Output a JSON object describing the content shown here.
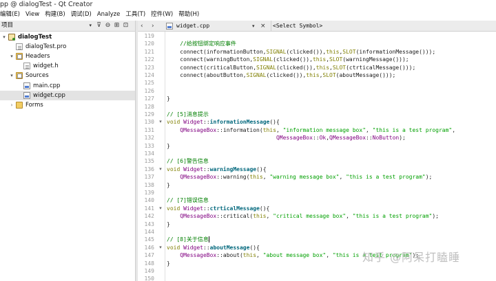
{
  "window": {
    "title": "pp @ dialogTest - Qt Creator"
  },
  "menu": [
    "编辑(E)",
    "View",
    "构建(B)",
    "调试(D)",
    "Analyze",
    "工具(T)",
    "控件(W)",
    "帮助(H)"
  ],
  "project_panel": {
    "combo_label": "项目",
    "tree": [
      {
        "label": "dialogTest",
        "level": 0,
        "expander": "▾",
        "icon": "project-icon",
        "bold": true
      },
      {
        "label": "dialogTest.pro",
        "level": 1,
        "expander": "",
        "icon": "pro-file-icon"
      },
      {
        "label": "Headers",
        "level": 1,
        "expander": "▾",
        "icon": "headers-folder-icon"
      },
      {
        "label": "widget.h",
        "level": 2,
        "expander": "",
        "icon": "header-file-icon"
      },
      {
        "label": "Sources",
        "level": 1,
        "expander": "▾",
        "icon": "sources-folder-icon"
      },
      {
        "label": "main.cpp",
        "level": 2,
        "expander": "",
        "icon": "cpp-file-icon"
      },
      {
        "label": "widget.cpp",
        "level": 2,
        "expander": "",
        "icon": "cpp-file-icon",
        "selected": true
      },
      {
        "label": "Forms",
        "level": 1,
        "expander": "›",
        "icon": "forms-folder-icon"
      }
    ]
  },
  "editor": {
    "file_name": "widget.cpp",
    "symbol_combo": "<Select Symbol>",
    "lines": [
      {
        "n": "119",
        "fold": "",
        "tokens": []
      },
      {
        "n": "120",
        "fold": "",
        "tokens": [
          {
            "c": "    "
          },
          {
            "c": "//给按钮绑定响应事件",
            "k": "c"
          }
        ]
      },
      {
        "n": "121",
        "fold": "",
        "tokens": [
          {
            "c": "    connect(informationButton,"
          },
          {
            "c": "SIGNAL",
            "k": "k"
          },
          {
            "c": "(clicked()),"
          },
          {
            "c": "this",
            "k": "k"
          },
          {
            "c": ","
          },
          {
            "c": "SLOT",
            "k": "k"
          },
          {
            "c": "(informationMessage()));"
          }
        ]
      },
      {
        "n": "122",
        "fold": "",
        "tokens": [
          {
            "c": "    connect(warningButton,"
          },
          {
            "c": "SIGNAL",
            "k": "k"
          },
          {
            "c": "(clicked()),"
          },
          {
            "c": "this",
            "k": "k"
          },
          {
            "c": ","
          },
          {
            "c": "SLOT",
            "k": "k"
          },
          {
            "c": "(warningMessage()));"
          }
        ]
      },
      {
        "n": "123",
        "fold": "",
        "tokens": [
          {
            "c": "    connect(criticalButton,"
          },
          {
            "c": "SIGNAL",
            "k": "k"
          },
          {
            "c": "(clicked()),"
          },
          {
            "c": "this",
            "k": "k"
          },
          {
            "c": ","
          },
          {
            "c": "SLOT",
            "k": "k"
          },
          {
            "c": "(ctrticalMessage()));"
          }
        ]
      },
      {
        "n": "124",
        "fold": "",
        "tokens": [
          {
            "c": "    connect(aboutButton,"
          },
          {
            "c": "SIGNAL",
            "k": "k"
          },
          {
            "c": "(clicked()),"
          },
          {
            "c": "this",
            "k": "k"
          },
          {
            "c": ","
          },
          {
            "c": "SLOT",
            "k": "k"
          },
          {
            "c": "(aboutMessage()));"
          }
        ]
      },
      {
        "n": "125",
        "fold": "",
        "tokens": []
      },
      {
        "n": "126",
        "fold": "",
        "tokens": []
      },
      {
        "n": "127",
        "fold": "",
        "tokens": [
          {
            "c": "}"
          }
        ]
      },
      {
        "n": "128",
        "fold": "",
        "tokens": []
      },
      {
        "n": "129",
        "fold": "",
        "tokens": [
          {
            "c": "// [5]消息提示",
            "k": "c"
          }
        ]
      },
      {
        "n": "130",
        "fold": "▾",
        "tokens": [
          {
            "c": "void",
            "k": "k"
          },
          {
            "c": " "
          },
          {
            "c": "Widget",
            "k": "cl"
          },
          {
            "c": "::"
          },
          {
            "c": "informationMessage",
            "k": "fn"
          },
          {
            "c": "(){"
          }
        ]
      },
      {
        "n": "131",
        "fold": "",
        "tokens": [
          {
            "c": "    "
          },
          {
            "c": "QMessageBox",
            "k": "t"
          },
          {
            "c": "::information("
          },
          {
            "c": "this",
            "k": "k"
          },
          {
            "c": ", "
          },
          {
            "c": "\"information message box\"",
            "k": "s"
          },
          {
            "c": ", "
          },
          {
            "c": "\"this is a test program\"",
            "k": "s"
          },
          {
            "c": ","
          }
        ]
      },
      {
        "n": "132",
        "fold": "",
        "tokens": [
          {
            "c": "                                 "
          },
          {
            "c": "QMessageBox",
            "k": "t"
          },
          {
            "c": "::"
          },
          {
            "c": "Ok",
            "k": "t"
          },
          {
            "c": ","
          },
          {
            "c": "QMessageBox",
            "k": "t"
          },
          {
            "c": "::"
          },
          {
            "c": "NoButton",
            "k": "t"
          },
          {
            "c": ");"
          }
        ]
      },
      {
        "n": "133",
        "fold": "",
        "tokens": [
          {
            "c": "}"
          }
        ]
      },
      {
        "n": "134",
        "fold": "",
        "tokens": []
      },
      {
        "n": "135",
        "fold": "",
        "tokens": [
          {
            "c": "// [6]警告信息",
            "k": "c"
          }
        ]
      },
      {
        "n": "136",
        "fold": "▾",
        "tokens": [
          {
            "c": "void",
            "k": "k"
          },
          {
            "c": " "
          },
          {
            "c": "Widget",
            "k": "cl"
          },
          {
            "c": "::"
          },
          {
            "c": "warningMessage",
            "k": "fn"
          },
          {
            "c": "(){"
          }
        ]
      },
      {
        "n": "137",
        "fold": "",
        "tokens": [
          {
            "c": "    "
          },
          {
            "c": "QMessageBox",
            "k": "t"
          },
          {
            "c": "::warning("
          },
          {
            "c": "this",
            "k": "k"
          },
          {
            "c": ", "
          },
          {
            "c": "\"warning message box\"",
            "k": "s"
          },
          {
            "c": ", "
          },
          {
            "c": "\"this is a test program\"",
            "k": "s"
          },
          {
            "c": ");"
          }
        ]
      },
      {
        "n": "138",
        "fold": "",
        "tokens": [
          {
            "c": "}"
          }
        ]
      },
      {
        "n": "139",
        "fold": "",
        "tokens": []
      },
      {
        "n": "140",
        "fold": "",
        "tokens": [
          {
            "c": "// [7]错误信息",
            "k": "c"
          }
        ]
      },
      {
        "n": "141",
        "fold": "▾",
        "tokens": [
          {
            "c": "void",
            "k": "k"
          },
          {
            "c": " "
          },
          {
            "c": "Widget",
            "k": "cl"
          },
          {
            "c": "::"
          },
          {
            "c": "ctrticalMessage",
            "k": "fn"
          },
          {
            "c": "(){"
          }
        ]
      },
      {
        "n": "142",
        "fold": "",
        "tokens": [
          {
            "c": "    "
          },
          {
            "c": "QMessageBox",
            "k": "t"
          },
          {
            "c": "::critical("
          },
          {
            "c": "this",
            "k": "k"
          },
          {
            "c": ", "
          },
          {
            "c": "\"critical message box\"",
            "k": "s"
          },
          {
            "c": ", "
          },
          {
            "c": "\"this is a test program\"",
            "k": "s"
          },
          {
            "c": ");"
          }
        ]
      },
      {
        "n": "143",
        "fold": "",
        "tokens": [
          {
            "c": "}"
          }
        ]
      },
      {
        "n": "144",
        "fold": "",
        "tokens": []
      },
      {
        "n": "145",
        "fold": "",
        "tokens": [
          {
            "c": "// [8]关于信息",
            "k": "c"
          }
        ],
        "cursor": true
      },
      {
        "n": "146",
        "fold": "▾",
        "tokens": [
          {
            "c": "void",
            "k": "k"
          },
          {
            "c": " "
          },
          {
            "c": "Widget",
            "k": "cl"
          },
          {
            "c": "::"
          },
          {
            "c": "aboutMessage",
            "k": "fn"
          },
          {
            "c": "(){"
          }
        ]
      },
      {
        "n": "147",
        "fold": "",
        "tokens": [
          {
            "c": "    "
          },
          {
            "c": "QMessageBox",
            "k": "t"
          },
          {
            "c": "::about("
          },
          {
            "c": "this",
            "k": "k"
          },
          {
            "c": ", "
          },
          {
            "c": "\"about message box\"",
            "k": "s"
          },
          {
            "c": ", "
          },
          {
            "c": "\"this is a test program\"",
            "k": "s"
          },
          {
            "c": ");"
          }
        ]
      },
      {
        "n": "148",
        "fold": "",
        "tokens": [
          {
            "c": "}"
          }
        ]
      },
      {
        "n": "149",
        "fold": "",
        "tokens": []
      },
      {
        "n": "150",
        "fold": "",
        "tokens": []
      }
    ]
  },
  "watermark": "知乎 @阿呆打瞌睡",
  "colors": {
    "keyword": "#7f7f00",
    "comment": "#007f00",
    "string": "#00a000",
    "type": "#800080",
    "function": "#00677c"
  }
}
